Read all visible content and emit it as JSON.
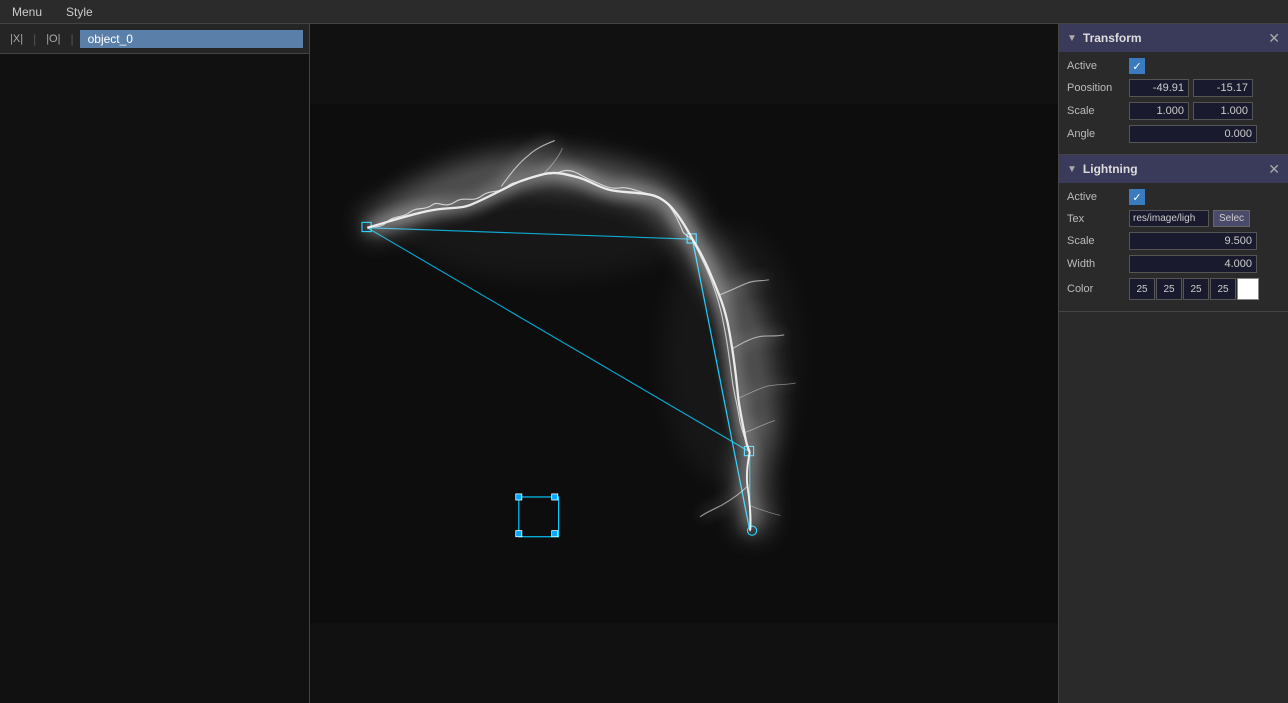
{
  "menubar": {
    "items": [
      "Menu",
      "Style"
    ]
  },
  "objectbar": {
    "btn_x_label": "|X|",
    "btn_o_label": "|O|",
    "object_name": "object_0"
  },
  "transform_panel": {
    "title": "Transform",
    "active_label": "Active",
    "active_checked": true,
    "position_label": "Poosition",
    "position_x": "-49.91",
    "position_y": "-15.17",
    "scale_label": "Scale",
    "scale_x": "1.000",
    "scale_y": "1.000",
    "angle_label": "Angle",
    "angle_value": "0.000"
  },
  "lightning_panel": {
    "title": "Lightning",
    "active_label": "Active",
    "active_checked": true,
    "tex_label": "Tex",
    "tex_value": "res/image/ligh",
    "tex_btn": "Selec",
    "scale_label": "Scale",
    "scale_value": "9.500",
    "width_label": "Width",
    "width_value": "4.000",
    "color_label": "Color",
    "color_r": "25",
    "color_g": "25",
    "color_b": "25",
    "color_a": "25",
    "color_hex": "#ffffff"
  },
  "canvas": {
    "bg_color": "#111111",
    "lightning_color": "#ffffff",
    "selection_color": "#00ccff"
  }
}
